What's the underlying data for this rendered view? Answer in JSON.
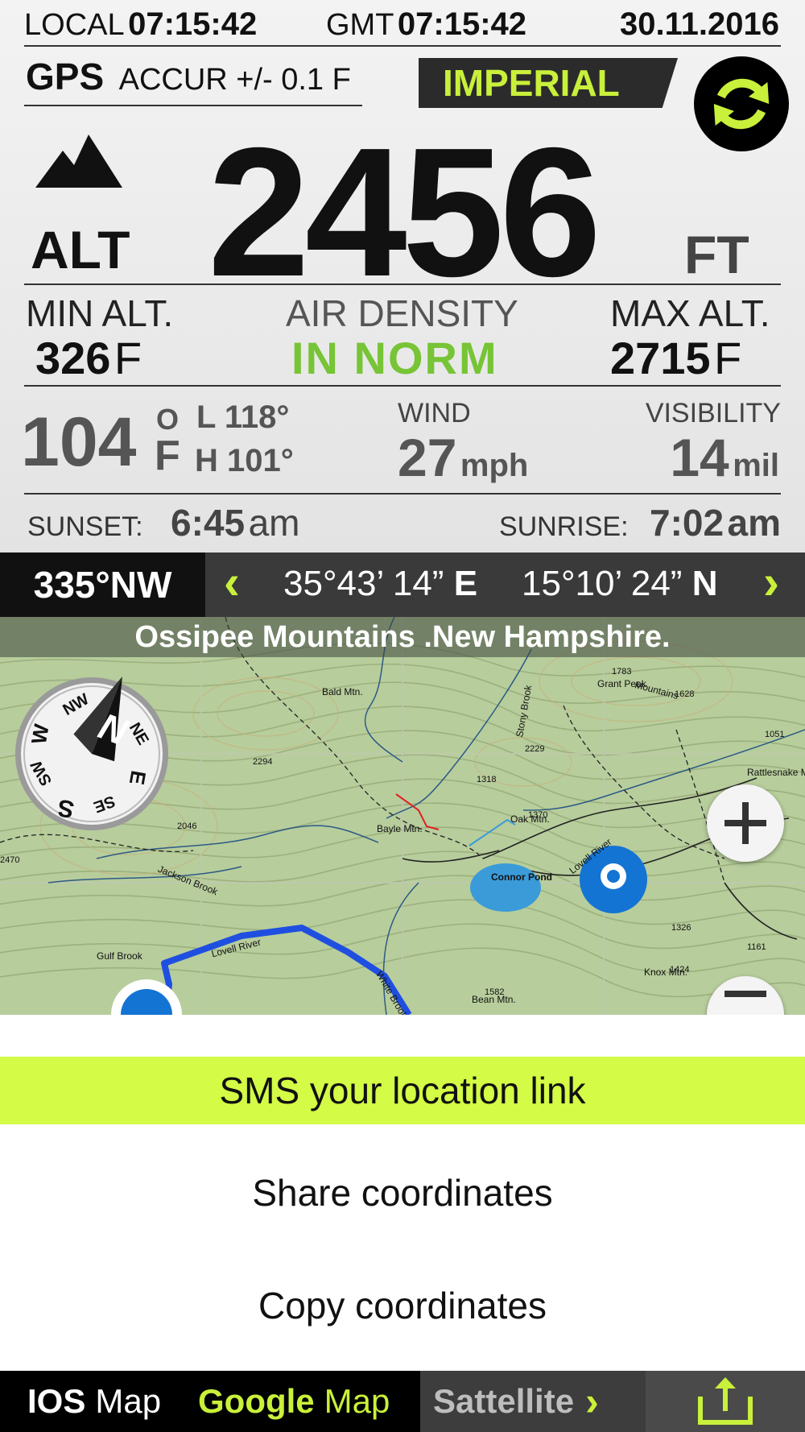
{
  "time_bar": {
    "local_label": "LOCAL",
    "local_time": "07:15:42",
    "gmt_label": "GMT",
    "gmt_time": "07:15:42",
    "date": "30.11.2016"
  },
  "gps": {
    "label": "GPS",
    "accuracy": "ACCUR +/- 0.1 F"
  },
  "units_button": "IMPERIAL",
  "altitude": {
    "label": "ALT",
    "value": "2456",
    "unit": "FT"
  },
  "min_alt": {
    "label": "MIN ALT.",
    "value": "326",
    "unit": "F"
  },
  "air_density": {
    "label": "AIR DENSITY",
    "value": "IN NORM"
  },
  "max_alt": {
    "label": "MAX ALT.",
    "value": "2715",
    "unit": "F"
  },
  "temperature": {
    "value": "104",
    "deg_mark": "O",
    "unit": "F",
    "low": "L 118°",
    "high": "H 101°"
  },
  "wind": {
    "label": "WIND",
    "value": "27",
    "unit": "mph"
  },
  "visibility": {
    "label": "VISIBILITY",
    "value": "14",
    "unit": "mil"
  },
  "sunset": {
    "label": "SUNSET:",
    "time": "6:45",
    "ampm": "am"
  },
  "sunrise": {
    "label": "SUNRISE:",
    "time": "7:02",
    "ampm": "am"
  },
  "heading": {
    "bearing": "335°NW",
    "lon": "35°43’ 14”",
    "lon_dir": "E",
    "lat": "15°10’ 24”",
    "lat_dir": "N"
  },
  "map": {
    "title": "Ossipee Mountains .New Hampshire.",
    "labels": {
      "bald": "Bald Mtn.",
      "grant": "Grant Peak",
      "mountains": "Mountains",
      "rattlesnake": "Rattlesnake Mtn.",
      "oak": "Oak Mtn.",
      "bayle": "Bayle Mtn.",
      "connor": "Connor Pond",
      "jackson": "Jackson Brook",
      "gulf": "Gulf Brook",
      "lovell": "Lovell River",
      "lovell2": "Lovell River",
      "bean": "Bean Mtn.",
      "knox": "Knox Mtn.",
      "stony": "Stony Brook",
      "white": "White Brook",
      "e2294": "2294",
      "e1318": "1318",
      "e2229": "2229",
      "e2046": "2046",
      "e1783": "1783",
      "e1628": "1628",
      "e1051": "1051",
      "e1370": "1370",
      "e1326": "1326",
      "e1582": "1582",
      "e1424": "1424",
      "e1161": "1161",
      "e2470": "2470"
    },
    "compass": {
      "n": "N",
      "ne": "NE",
      "e": "E",
      "se": "SE",
      "s": "S",
      "sw": "SW",
      "w": "W",
      "nw": "NW"
    },
    "route_color": "#1f4fe0"
  },
  "share_sheet": {
    "sms": "SMS your location link",
    "share": "Share coordinates",
    "copy": "Copy coordinates"
  },
  "bottom_bar": {
    "ios_bold": "IOS",
    "ios_rest": "Map",
    "google_bold": "Google",
    "google_rest": "Map",
    "satellite": "Sattellite"
  },
  "colors": {
    "accent": "#c9f03a",
    "sms_bg": "#d4fb45",
    "norm_green": "#77c436"
  }
}
